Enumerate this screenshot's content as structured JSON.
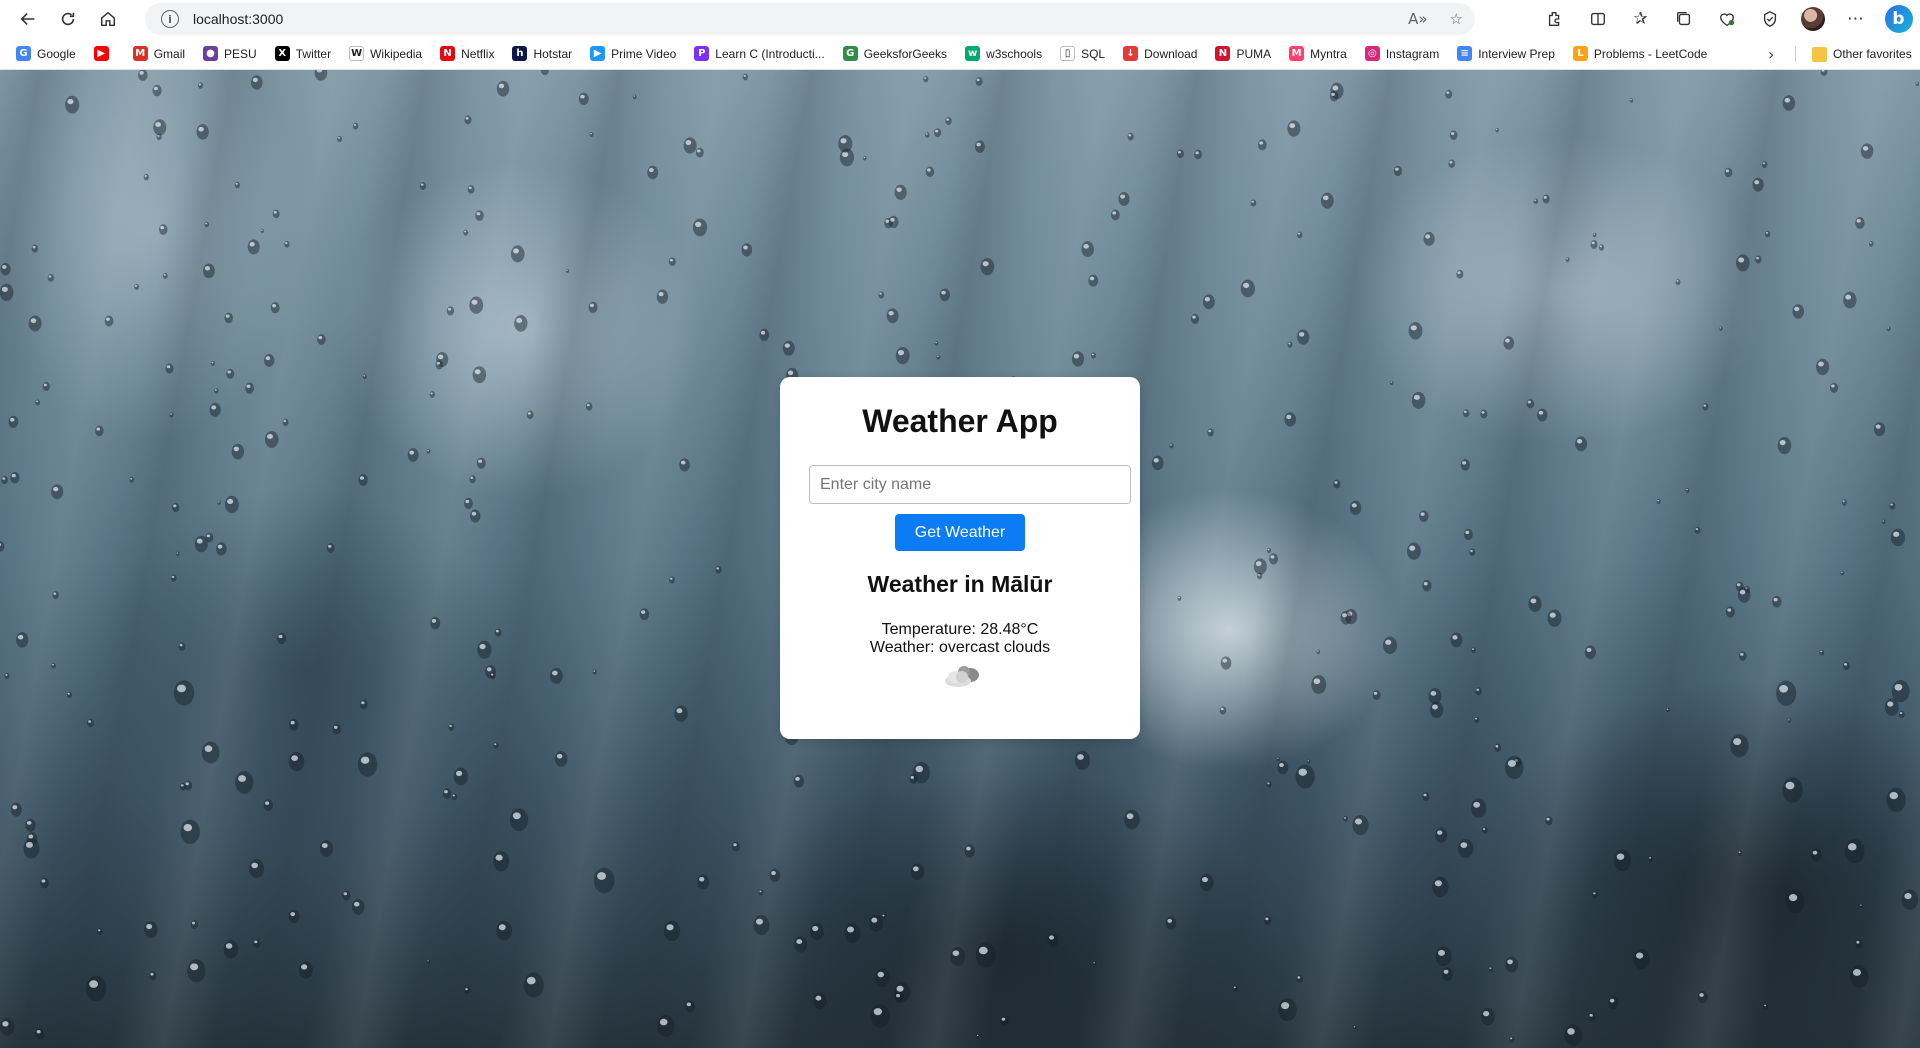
{
  "browser": {
    "url": "localhost:3000",
    "bookmarks": [
      {
        "label": "Google",
        "icon": "google-icon",
        "color": "#4285f4",
        "glyph": "G"
      },
      {
        "label": "",
        "icon": "youtube-icon",
        "color": "#ff0000",
        "glyph": "▶"
      },
      {
        "label": "Gmail",
        "icon": "gmail-icon",
        "color": "#d93025",
        "glyph": "M"
      },
      {
        "label": "PESU",
        "icon": "pesu-icon",
        "color": "#6a3fa0",
        "glyph": "●"
      },
      {
        "label": "Twitter",
        "icon": "x-icon",
        "color": "#000000",
        "glyph": "X"
      },
      {
        "label": "Wikipedia",
        "icon": "wikipedia-icon",
        "color": "#ffffff",
        "glyph": "W"
      },
      {
        "label": "Netflix",
        "icon": "netflix-icon",
        "color": "#e50914",
        "glyph": "N"
      },
      {
        "label": "Hotstar",
        "icon": "hotstar-icon",
        "color": "#0c1a4a",
        "glyph": "h"
      },
      {
        "label": "Prime Video",
        "icon": "prime-video-icon",
        "color": "#1a98ff",
        "glyph": "▶"
      },
      {
        "label": "Learn C (Introducti...",
        "icon": "learn-c-icon",
        "color": "#7b2ff7",
        "glyph": "P"
      },
      {
        "label": "GeeksforGeeks",
        "icon": "geeksforgeeks-icon",
        "color": "#2f8d46",
        "glyph": "G"
      },
      {
        "label": "w3schools",
        "icon": "w3schools-icon",
        "color": "#04aa6d",
        "glyph": "w"
      },
      {
        "label": "SQL",
        "icon": "document-icon",
        "color": "#ffffff",
        "glyph": "▯"
      },
      {
        "label": "Download",
        "icon": "download-icon",
        "color": "#e53935",
        "glyph": "↓"
      },
      {
        "label": "PUMA",
        "icon": "puma-icon",
        "color": "#d3132b",
        "glyph": "N"
      },
      {
        "label": "Myntra",
        "icon": "myntra-icon",
        "color": "#ff3f6c",
        "glyph": "M"
      },
      {
        "label": "Instagram",
        "icon": "instagram-icon",
        "color": "#d62976",
        "glyph": "◎"
      },
      {
        "label": "Interview Prep",
        "icon": "docs-icon",
        "color": "#4285f4",
        "glyph": "≡"
      },
      {
        "label": "Problems - LeetCode",
        "icon": "leetcode-icon",
        "color": "#ffa116",
        "glyph": "L"
      }
    ],
    "other_favorites": "Other favorites"
  },
  "app": {
    "title": "Weather App",
    "input_placeholder": "Enter city name",
    "input_value": "",
    "button_label": "Get Weather",
    "result_heading": "Weather in Mālūr",
    "temperature_text": "Temperature: 28.48°C",
    "weather_text": "Weather: overcast clouds",
    "weather_icon": "overcast-clouds-icon"
  }
}
